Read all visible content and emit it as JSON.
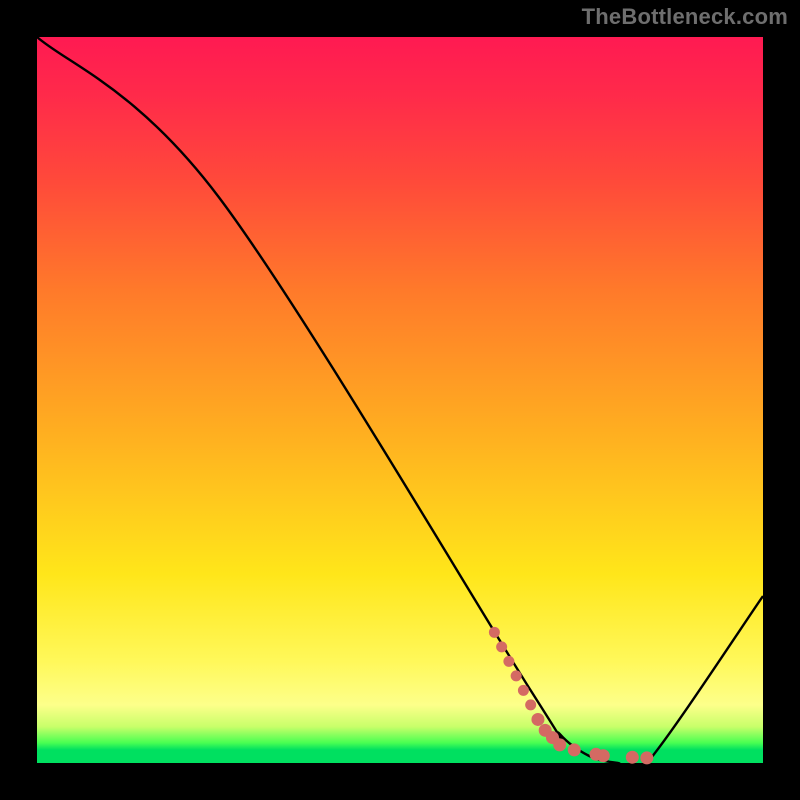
{
  "attribution": "TheBottleneck.com",
  "chart_data": {
    "type": "line",
    "title": "",
    "xlabel": "",
    "ylabel": "",
    "xlim": [
      0,
      100
    ],
    "ylim": [
      0,
      100
    ],
    "series": [
      {
        "name": "bottleneck-curve",
        "x": [
          0,
          25,
          68,
          72,
          76,
          80,
          84,
          100
        ],
        "values": [
          100,
          78,
          10,
          4,
          1,
          0,
          0,
          23
        ]
      }
    ],
    "markers": {
      "name": "highlight-dots",
      "color": "#d46a63",
      "points": [
        {
          "x": 63,
          "y": 18
        },
        {
          "x": 64,
          "y": 16
        },
        {
          "x": 65,
          "y": 14
        },
        {
          "x": 66,
          "y": 12
        },
        {
          "x": 67,
          "y": 10
        },
        {
          "x": 68,
          "y": 8
        },
        {
          "x": 69,
          "y": 6
        },
        {
          "x": 70,
          "y": 4.5
        },
        {
          "x": 71,
          "y": 3.5
        },
        {
          "x": 72,
          "y": 2.5
        },
        {
          "x": 74,
          "y": 1.8
        },
        {
          "x": 77,
          "y": 1.2
        },
        {
          "x": 78,
          "y": 1.0
        },
        {
          "x": 82,
          "y": 0.8
        },
        {
          "x": 84,
          "y": 0.7
        }
      ]
    },
    "gradient_stops": [
      {
        "pos": 0.0,
        "color": "#ff1a52"
      },
      {
        "pos": 0.55,
        "color": "#ffe61a"
      },
      {
        "pos": 0.95,
        "color": "#c8ff6a"
      },
      {
        "pos": 1.0,
        "color": "#00e060"
      }
    ]
  }
}
